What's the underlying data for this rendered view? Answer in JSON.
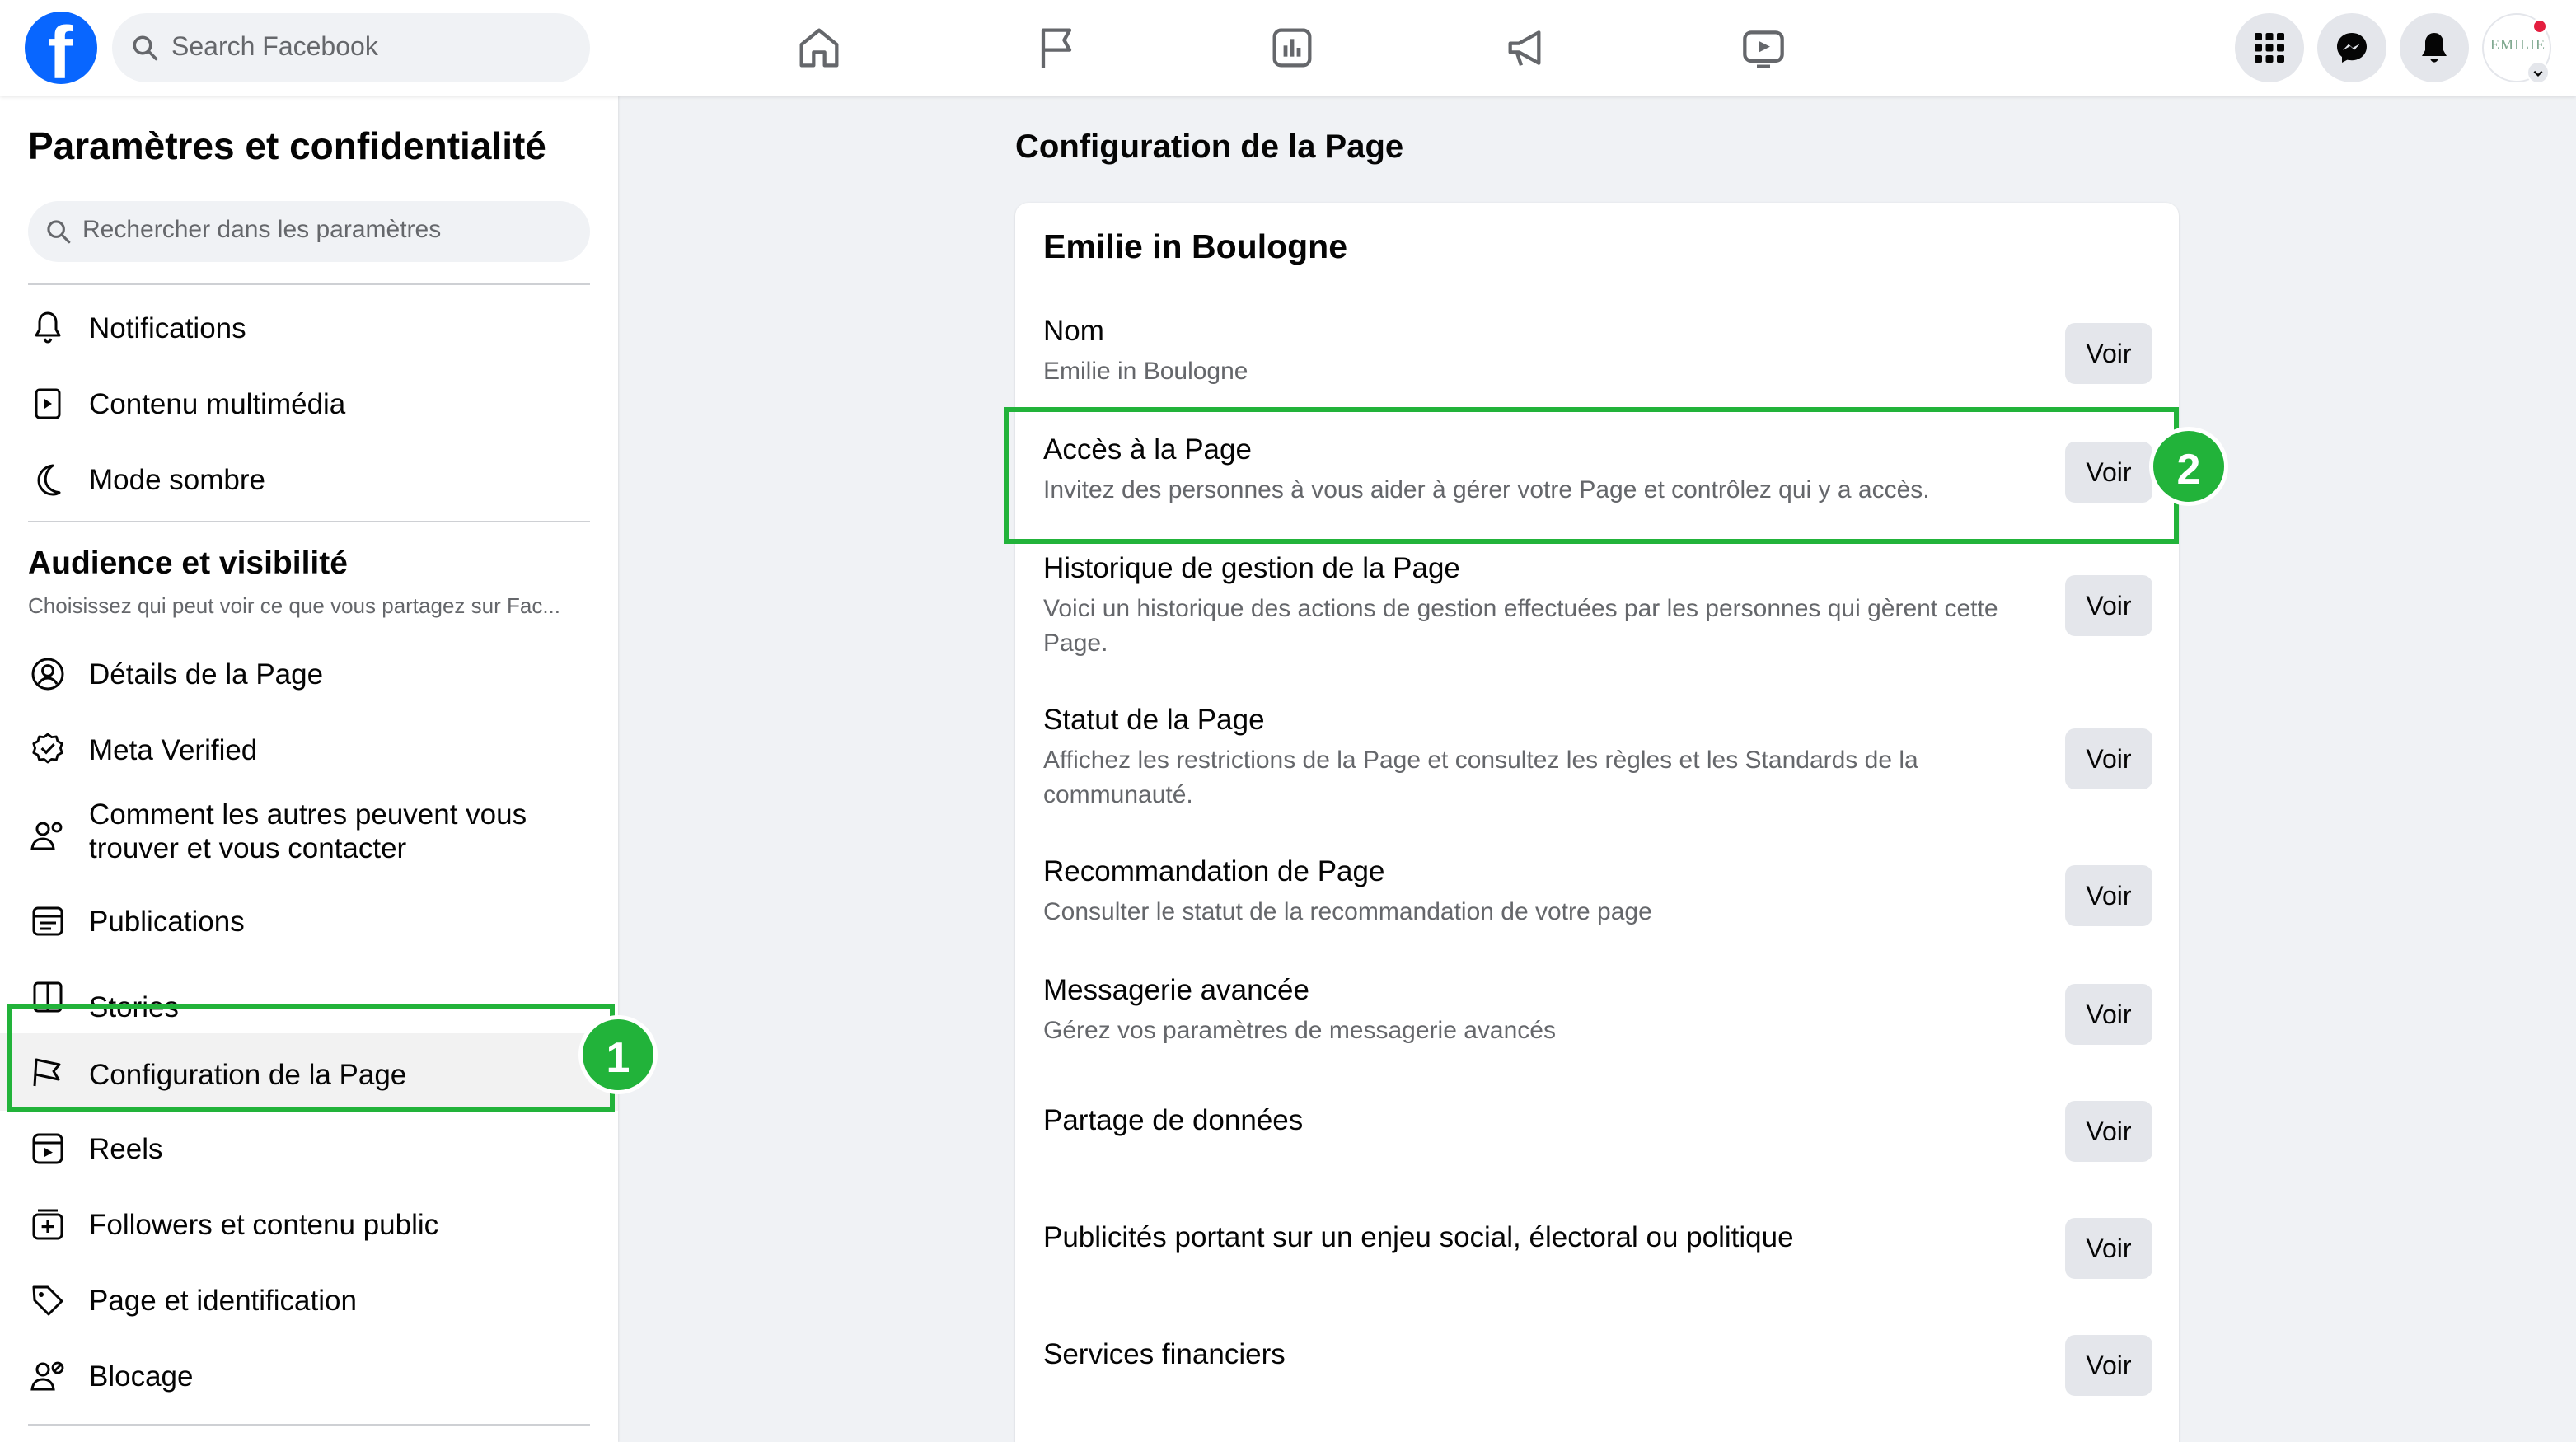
{
  "topbar": {
    "logo_letter": "f",
    "search_placeholder": "Search Facebook",
    "nav_icons": [
      "home-icon",
      "flag-icon",
      "insights-icon",
      "megaphone-icon",
      "video-icon"
    ],
    "right_icons": [
      "apps-grid-icon",
      "messenger-icon",
      "notifications-bell-icon"
    ],
    "avatar_text": "EMILIE"
  },
  "sidebar": {
    "title": "Paramètres et confidentialité",
    "search_placeholder": "Rechercher dans les paramètres",
    "items_top": [
      {
        "label": "Notifications",
        "icon": "bell-icon"
      },
      {
        "label": "Contenu multimédia",
        "icon": "media-icon"
      },
      {
        "label": "Mode sombre",
        "icon": "moon-icon"
      }
    ],
    "section_title": "Audience et visibilité",
    "section_subtitle": "Choisissez qui peut voir ce que vous partagez sur Fac...",
    "items": [
      {
        "label": "Détails de la Page",
        "icon": "user-circle-icon"
      },
      {
        "label": "Meta Verified",
        "icon": "verified-badge-icon"
      },
      {
        "label": "Comment les autres peuvent vous",
        "label2": "trouver et vous contacter",
        "icon": "people-icon"
      },
      {
        "label": "Publications",
        "icon": "posts-icon"
      },
      {
        "label": "Stories",
        "icon": "book-icon"
      },
      {
        "label": "Configuration de la Page",
        "icon": "flag-icon",
        "active": true
      },
      {
        "label": "Reels",
        "icon": "reels-icon"
      },
      {
        "label": "Followers et contenu public",
        "icon": "add-box-icon"
      },
      {
        "label": "Page et identification",
        "icon": "tag-icon"
      },
      {
        "label": "Blocage",
        "icon": "block-user-icon"
      }
    ]
  },
  "main": {
    "title": "Configuration de la Page",
    "card_title": "Emilie in Boulogne",
    "button_label": "Voir",
    "rows": [
      {
        "title": "Nom",
        "desc": "Emilie in Boulogne"
      },
      {
        "title": "Accès à la Page",
        "desc": "Invitez des personnes à vous aider à gérer votre Page et contrôlez qui y a accès."
      },
      {
        "title": "Historique de gestion de la Page",
        "desc": "Voici un historique des actions de gestion effectuées par les personnes qui gèrent cette Page."
      },
      {
        "title": "Statut de la Page",
        "desc": "Affichez les restrictions de la Page et consultez les règles et les Standards de la communauté."
      },
      {
        "title": "Recommandation de Page",
        "desc": "Consulter le statut de la recommandation de votre page"
      },
      {
        "title": "Messagerie avancée",
        "desc": "Gérez vos paramètres de messagerie avancés"
      },
      {
        "title": "Partage de données",
        "desc": ""
      },
      {
        "title": "Publicités portant sur un enjeu social, électoral ou politique",
        "desc": ""
      },
      {
        "title": "Services financiers",
        "desc": ""
      }
    ]
  },
  "annotations": {
    "badge1": "1",
    "badge2": "2",
    "color": "#22b33a"
  }
}
